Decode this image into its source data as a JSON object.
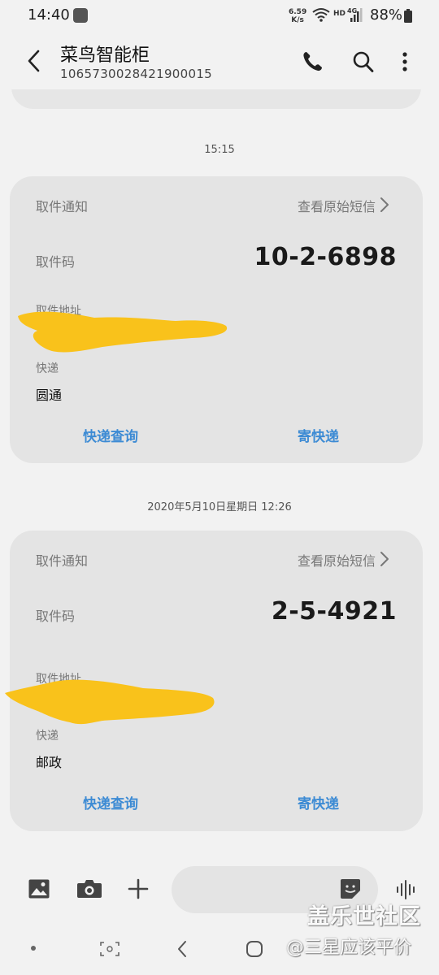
{
  "status_bar": {
    "time": "14:40",
    "net_speed_value": "6.59",
    "net_speed_unit": "K/s",
    "hd_label": "HD",
    "network_label": "4G",
    "battery": "88%"
  },
  "header": {
    "contact_name": "菜鸟智能柜",
    "contact_number": "1065730028421900015"
  },
  "messages": [
    {
      "timestamp": "15:15",
      "kind": "取件通知",
      "view_original": "查看原始短信",
      "code_label": "取件码",
      "code": "10-2-6898",
      "address_label": "取件地址",
      "courier_label": "快递",
      "courier": "圆通",
      "track_button": "快递查询",
      "send_button": "寄快递"
    },
    {
      "timestamp": "2020年5月10日星期日 12:26",
      "kind": "取件通知",
      "view_original": "查看原始短信",
      "code_label": "取件码",
      "code": "2-5-4921",
      "address_label": "取件地址",
      "courier_label": "快递",
      "courier": "邮政",
      "track_button": "快递查询",
      "send_button": "寄快递"
    }
  ],
  "redaction_color": "#f9c21b",
  "accent_color": "#3d8bd4",
  "watermark": {
    "line1": "盖乐世社区",
    "line2": "@三星应该平价"
  }
}
